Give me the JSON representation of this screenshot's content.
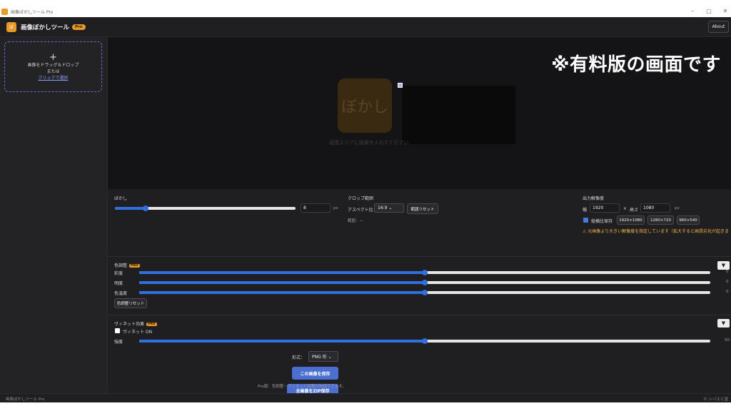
{
  "window": {
    "title": "画像ぼかしツール Pro",
    "controls": [
      "–",
      "▢",
      "✕"
    ]
  },
  "header": {
    "app_name": "画像ぼかしツール",
    "pro_badge": "Pro",
    "about_label": "About",
    "logo_text": "ぼ"
  },
  "sidebar": {
    "plus": "+",
    "line1": "画像をドラッグ＆ドロップ",
    "line2": "または",
    "link": "クリックで選択"
  },
  "preview": {
    "watermark": "※有料版の画面です",
    "placeholder_logo": "ぼかし",
    "placeholder_text": "画面エリアに画像を入れてください"
  },
  "blur": {
    "label": "ぼかし",
    "value": "8",
    "unit": "px",
    "slider_fraction": 0.17
  },
  "crop": {
    "label": "クロップ範囲",
    "aspect_label": "アスペクト比",
    "aspect_value": "16:9",
    "reset_label": "範囲リセット",
    "range_text": "範囲：—"
  },
  "output": {
    "label": "出力解像度",
    "width_label": "幅",
    "width_value": "1920",
    "height_label": "高さ",
    "height_value": "1080",
    "unit": "px",
    "sep": "×",
    "keep_ratio_label": "縦横比保持",
    "keep_ratio_checked": true,
    "presets": [
      "1920×1080",
      "1280×720",
      "960×540"
    ],
    "warning": "⚠ 元画像より大きい解像度を指定しています（拡大すると画質劣化が起きます）"
  },
  "color": {
    "label": "色調整",
    "badge": "PRO",
    "rows": [
      {
        "label": "彩度",
        "value": "0",
        "fraction": 0.5
      },
      {
        "label": "明度",
        "value": "0",
        "fraction": 0.5
      },
      {
        "label": "色温度",
        "value": "0",
        "fraction": 0.5
      }
    ],
    "reset_label": "色調整リセット",
    "toggle": "▼"
  },
  "vignette": {
    "label": "ヴィネット効果",
    "badge": "PRO",
    "toggle_label": "ヴィネット ON",
    "strength_label": "強度",
    "strength_value": "50",
    "fraction": 0.5,
    "toggle": "▼"
  },
  "save": {
    "format_label": "形式：",
    "format_value": "PNG 形",
    "save_button": "この画像を保存",
    "zip_button": "全画像をZIP保存",
    "note": "Pro版：色調整・ヴィネット効果が利用できます。"
  },
  "footer": {
    "left": "画像ぼかしツール Pro",
    "right": "© シバエと堂"
  },
  "colors": {
    "accent": "#2f6fe0",
    "brand": "#e79a2a",
    "warning": "#f0b541",
    "background": "#1f1f22"
  }
}
